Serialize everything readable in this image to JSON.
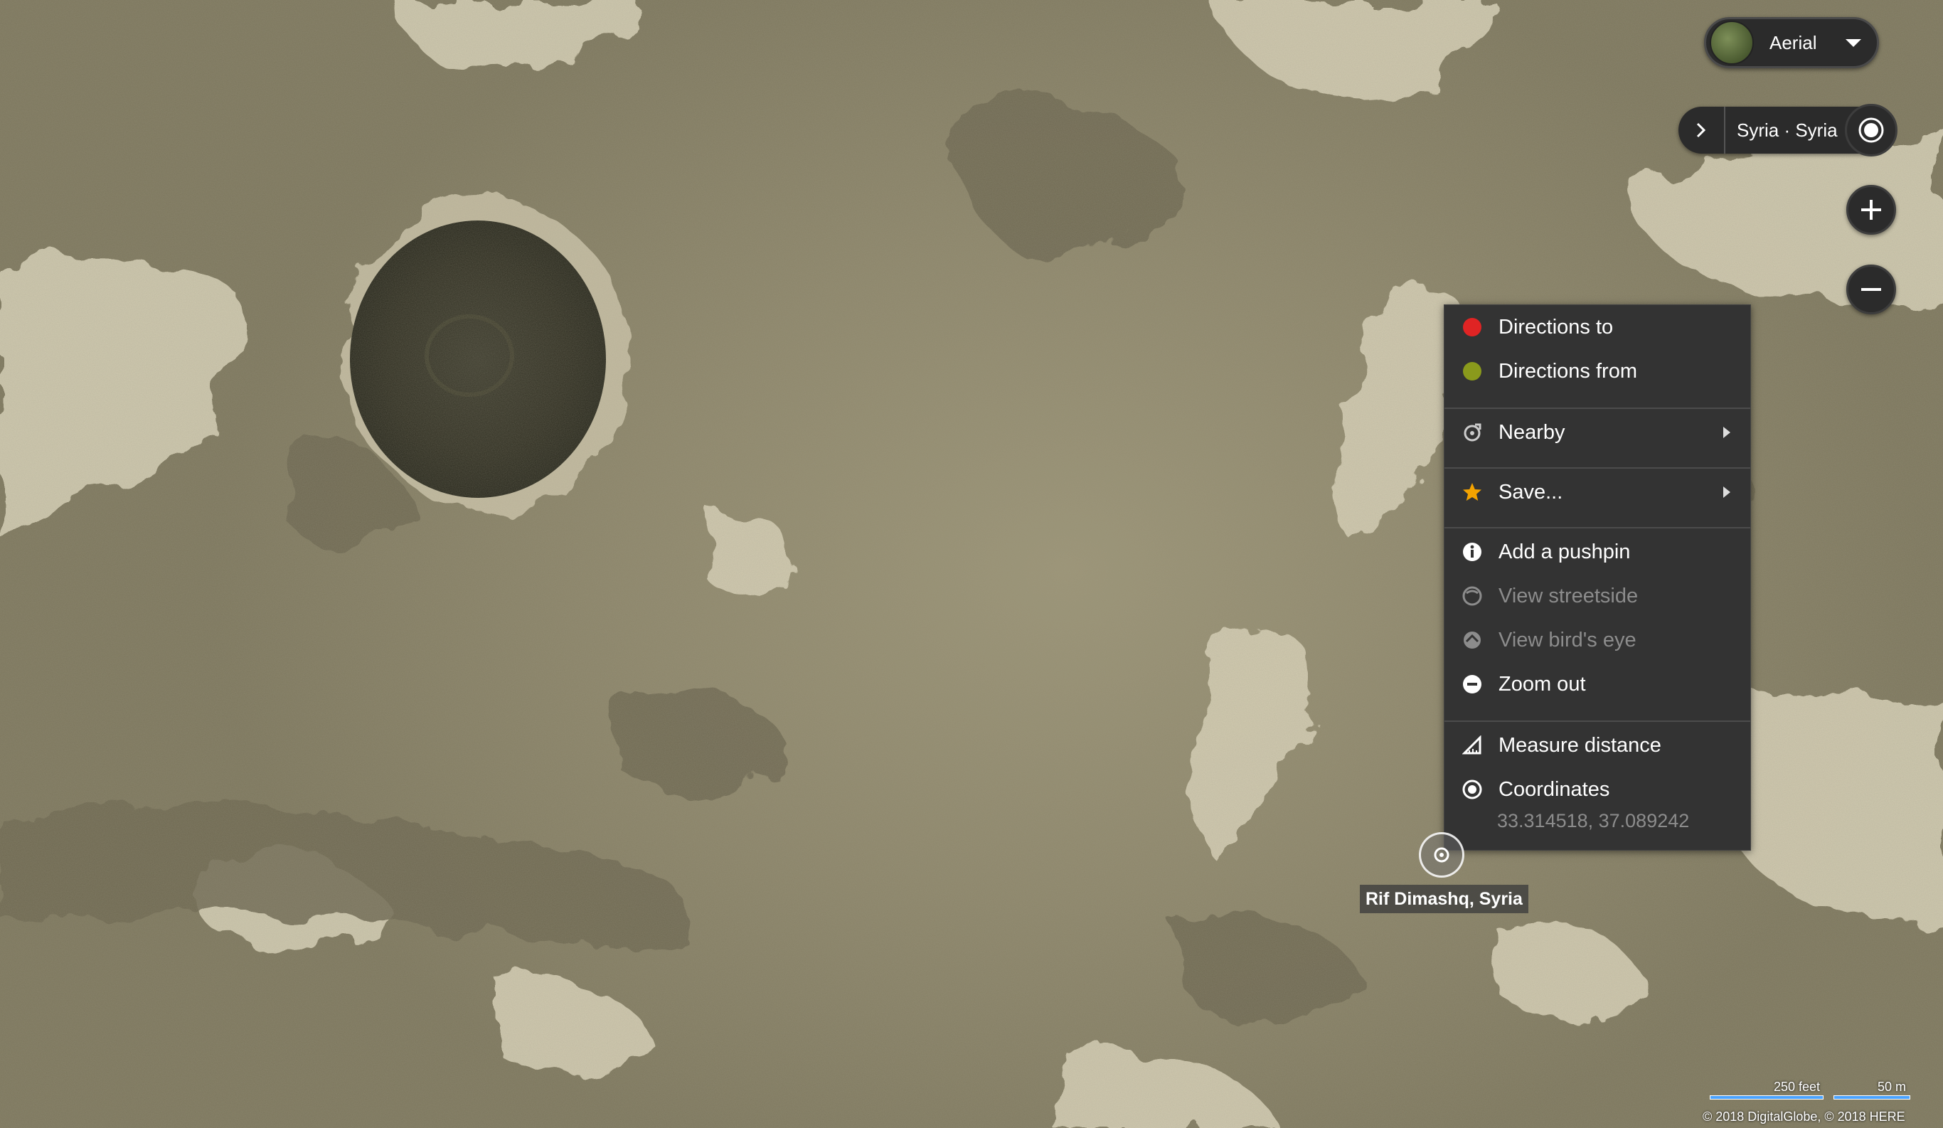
{
  "map": {
    "style": "Aerial",
    "location_breadcrumb": "Syria · Syria",
    "pin_label": "Rif Dimashq, Syria"
  },
  "context_menu": {
    "items": [
      {
        "label": "Directions to",
        "icon": "red-dot-icon",
        "enabled": true
      },
      {
        "label": "Directions from",
        "icon": "green-dot-icon",
        "enabled": true
      },
      {
        "label": "Nearby",
        "icon": "nearby-icon",
        "enabled": true,
        "submenu": true
      },
      {
        "label": "Save...",
        "icon": "star-icon",
        "enabled": true,
        "submenu": true
      },
      {
        "label": "Add a pushpin",
        "icon": "info-icon",
        "enabled": true
      },
      {
        "label": "View streetside",
        "icon": "streetside-icon",
        "enabled": false
      },
      {
        "label": "View bird's eye",
        "icon": "birds-eye-icon",
        "enabled": false
      },
      {
        "label": "Zoom out",
        "icon": "minus-circle-icon",
        "enabled": true
      },
      {
        "label": "Measure distance",
        "icon": "ruler-icon",
        "enabled": true
      },
      {
        "label": "Coordinates",
        "icon": "target-icon",
        "enabled": true
      }
    ],
    "coordinates_value": "33.314518, 37.089242"
  },
  "scale": {
    "imperial": "250 feet",
    "metric": "50 m"
  },
  "copyright": "© 2018 DigitalGlobe, © 2018 HERE",
  "colors": {
    "panel_bg": "#333333",
    "directions_to": "#e02424",
    "directions_from": "#8a9a1c",
    "star": "#f4a300",
    "scale_bar": "#4aa3ff"
  }
}
